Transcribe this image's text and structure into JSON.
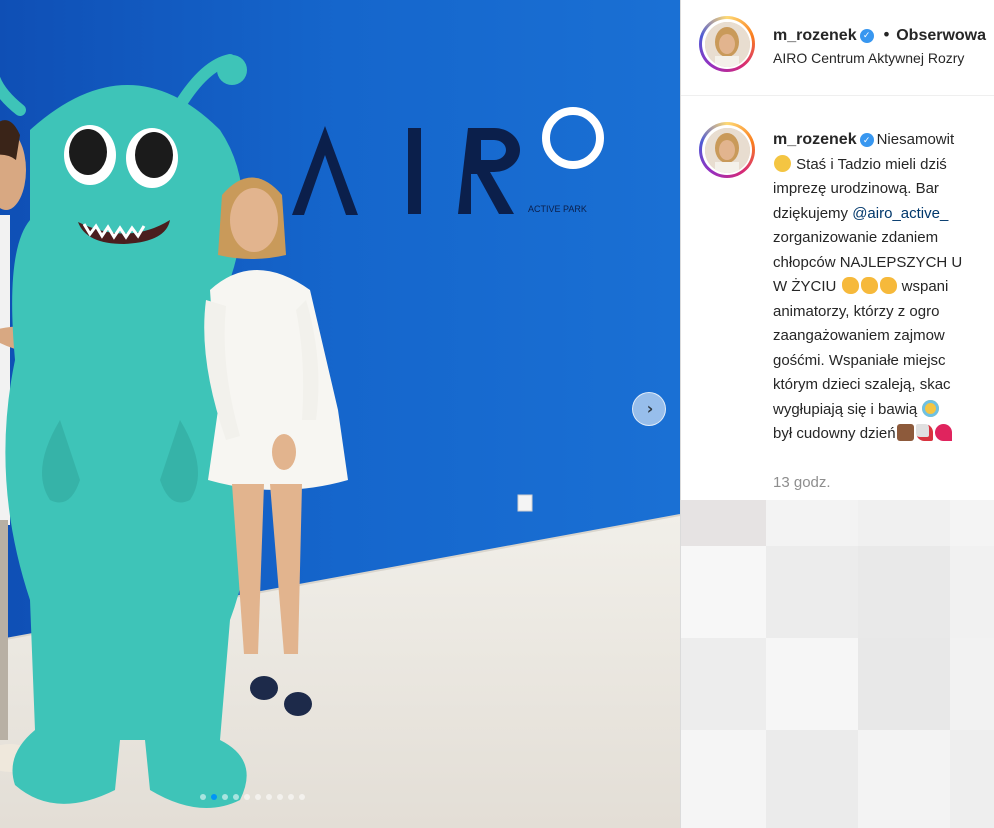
{
  "photo": {
    "wall_logo_text": "AIR",
    "wall_logo_o": "O",
    "wall_logo_sub": "ACTIVE PARK",
    "next_icon": "chevron-right-icon",
    "carousel_dots": 10,
    "carousel_active_index": 1
  },
  "header": {
    "username": "m_rozenek",
    "separator": "•",
    "follow_label": "Obserwowa",
    "location": "AIRO Centrum Aktywnej Rozry"
  },
  "caption": {
    "username": "m_rozenek",
    "line1": "Niesamowit",
    "line2": "Staś i Tadzio mieli dziś",
    "line3": "imprezę urodzinową. Bar",
    "line4_pre": "dziękujemy ",
    "mention": "@airo_active_",
    "line5": "zorganizowanie zdaniem",
    "line6": "chłopców NAJLEPSZYCH U",
    "line7_pre": "W ŻYCIU ",
    "line7_post": " wspani",
    "line8": "animatorzy, którzy z ogro",
    "line9": "zaangażowaniem zajmow",
    "line10": "gośćmi. Wspaniałe miejsc",
    "line11": "którym dzieci szaleją, skac",
    "line12": "wygłupiają się i bawią ",
    "line13": "był cudowny dzień",
    "time": "13 godz."
  },
  "colors": {
    "wall_blue": "#1363c8",
    "mascot_teal": "#3ec4b8",
    "verified_blue": "#3897f0",
    "mention_blue": "#00376b",
    "carousel_active": "#0095f6"
  }
}
